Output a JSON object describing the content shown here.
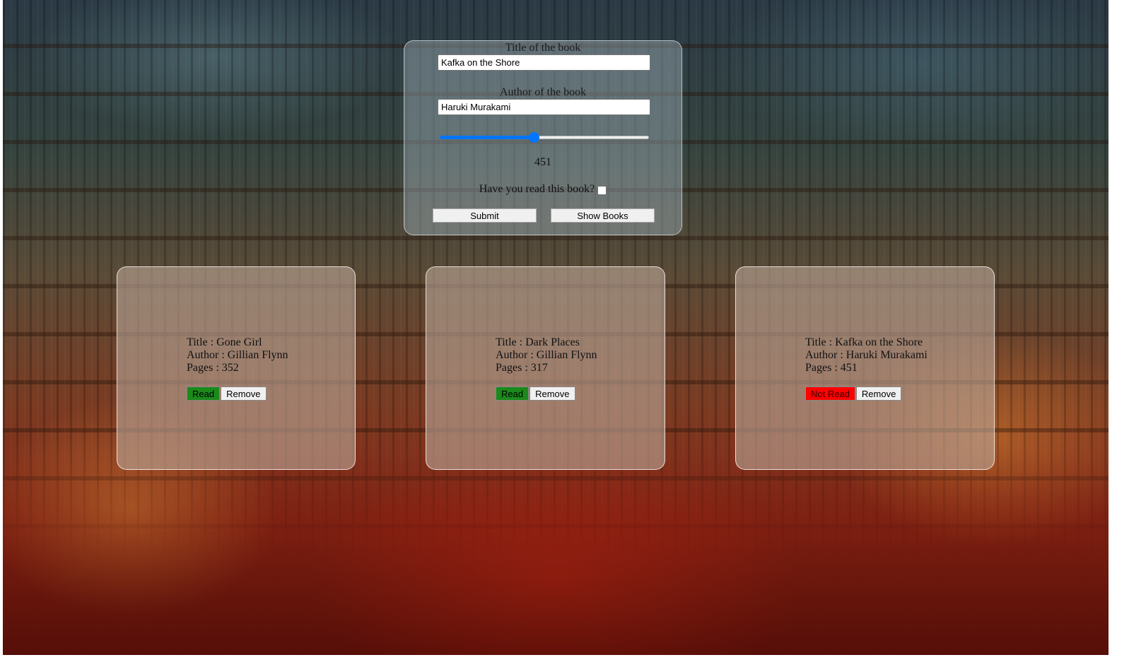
{
  "form": {
    "title_label": "Title of the book",
    "title_value": "Kafka on the Shore",
    "author_label": "Author of the book",
    "author_value": "Haruki Murakami",
    "pages_slider": {
      "value": 451,
      "fraction": 0.45
    },
    "pages_display": "451",
    "read_question": "Have you read this book?",
    "read_checked": false,
    "submit_label": "Submit",
    "show_books_label": "Show Books"
  },
  "books": [
    {
      "title_text": "Title : Gone Girl",
      "author_text": "Author : Gillian Flynn",
      "pages_text": "Pages : 352",
      "status_label": "Read",
      "status": "read",
      "remove_label": "Remove"
    },
    {
      "title_text": "Title : Dark Places",
      "author_text": "Author : Gillian Flynn",
      "pages_text": "Pages : 317",
      "status_label": "Read",
      "status": "read",
      "remove_label": "Remove"
    },
    {
      "title_text": "Title : Kafka on the Shore",
      "author_text": "Author : Haruki Murakami",
      "pages_text": "Pages : 451",
      "status_label": "Not Read",
      "status": "notread",
      "remove_label": "Remove"
    }
  ],
  "colors": {
    "read": "#1a8a1a",
    "not_read": "#ff0000",
    "slider_accent": "#0075ff"
  }
}
